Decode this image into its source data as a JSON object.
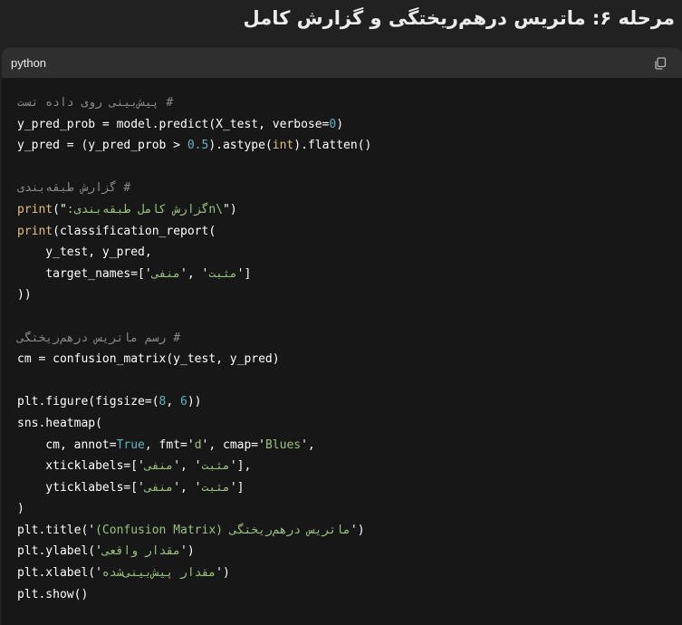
{
  "heading": "مرحله ۶: ماتریس درهم‌ریختگی و گزارش کامل",
  "code_block": {
    "language": "python",
    "copy_icon": "copy-icon"
  },
  "code": {
    "l1_comment": "# پیش‌بینی روی داده تست",
    "l2": "y_pred_prob = model.predict(X_test, verbose=",
    "l2_num": "0",
    "l2_end": ")",
    "l3_a": "y_pred = (y_pred_prob > ",
    "l3_num": "0.5",
    "l3_b": ").astype(",
    "l3_kw": "int",
    "l3_c": ").flatten()",
    "l5_comment": "# گزارش طبقه‌بندی",
    "l6_fn": "print",
    "l6_a": "(\"",
    "l6_str": "\\nگزارش کامل طبقه‌بندی:",
    "l6_b": "\")",
    "l7_fn": "print",
    "l7_rest": "(classification_report(",
    "l8": "    y_test, y_pred,",
    "l9_a": "    target_names=['",
    "l9_s1": "منفی",
    "l9_b": "', '",
    "l9_s2": "مثبت",
    "l9_c": "']",
    "l10": "))",
    "l12_comment": "# رسم ماتریس درهم‌ریختگی",
    "l13": "cm = confusion_matrix(y_test, y_pred)",
    "l15_a": "plt.figure(figsize=(",
    "l15_n1": "8",
    "l15_b": ", ",
    "l15_n2": "6",
    "l15_c": "))",
    "l16": "sns.heatmap(",
    "l17_a": "    cm, annot=",
    "l17_kw": "True",
    "l17_b": ", fmt='",
    "l17_s1": "d",
    "l17_c": "', cmap='",
    "l17_s2": "Blues",
    "l17_d": "',",
    "l18_a": "    xticklabels=['",
    "l18_s1": "منفی",
    "l18_b": "', '",
    "l18_s2": "مثبت",
    "l18_c": "'],",
    "l19_a": "    yticklabels=['",
    "l19_s1": "منفی",
    "l19_b": "', '",
    "l19_s2": "مثبت",
    "l19_c": "']",
    "l20": ")",
    "l21_a": "plt.title('",
    "l21_s": "ماتریس درهم‌ریختگی (Confusion Matrix)",
    "l21_b": "')",
    "l22_a": "plt.ylabel('",
    "l22_s": "مقدار واقعی",
    "l22_b": "')",
    "l23_a": "plt.xlabel('",
    "l23_s": "مقدار پیش‌بینی‌شده",
    "l23_b": "')",
    "l24": "plt.show()"
  }
}
